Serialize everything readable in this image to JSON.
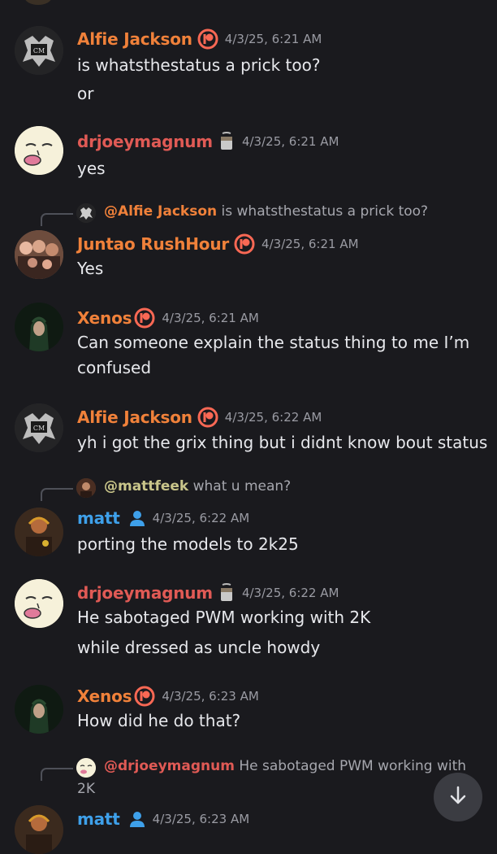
{
  "colors": {
    "background": "#1a1a1e",
    "orange_name": "#f0813a",
    "red_name": "#e05a55",
    "blue_name": "#3ea0ea",
    "olive_name": "#c9c58a",
    "patreon": "#f96854",
    "timestamp": "#9a9ba3"
  },
  "messages": [
    {
      "username": "Alfie Jackson",
      "badge": "patreon-icon",
      "timestamp": "4/3/25, 6:21 AM",
      "lines": [
        "is whatsthestatus a prick too?",
        "or"
      ]
    },
    {
      "username": "drjoeymagnum",
      "badge": "paint-bucket-icon",
      "timestamp": "4/3/25, 6:21 AM",
      "lines": [
        "yes"
      ]
    },
    {
      "reply": {
        "mention": "@Alfie Jackson",
        "text": "is whatsthestatus a prick too?"
      },
      "username": "Juntao RushHour",
      "badge": "patreon-icon",
      "timestamp": "4/3/25, 6:21 AM",
      "lines": [
        "Yes"
      ]
    },
    {
      "username": "Xenos",
      "badge": "patreon-icon",
      "timestamp": "4/3/25, 6:21 AM",
      "lines": [
        "Can someone explain the status thing to me I’m",
        "confused"
      ]
    },
    {
      "username": "Alfie Jackson",
      "badge": "patreon-icon",
      "timestamp": "4/3/25, 6:22 AM",
      "lines": [
        "yh i got the grix thing but i didnt know bout status"
      ]
    },
    {
      "reply": {
        "mention": "@mattfeek",
        "text": "what u mean?"
      },
      "username": "matt",
      "badge": "person-icon",
      "timestamp": "4/3/25, 6:22 AM",
      "lines": [
        "porting the models to 2k25"
      ]
    },
    {
      "username": "drjoeymagnum",
      "badge": "paint-bucket-icon",
      "timestamp": "4/3/25, 6:22 AM",
      "lines": [
        "He sabotaged PWM working with 2K",
        "while dressed as uncle howdy"
      ]
    },
    {
      "username": "Xenos",
      "badge": "patreon-icon",
      "timestamp": "4/3/25, 6:23 AM",
      "lines": [
        "How did he do that?"
      ]
    },
    {
      "reply": {
        "mention": "@drjoeymagnum",
        "text": "He sabotaged PWM working with",
        "text2": "2K"
      },
      "username": "matt",
      "badge": "person-icon",
      "timestamp": "4/3/25, 6:23 AM",
      "lines": []
    }
  ],
  "scroll_button": {
    "icon": "arrow-down-icon"
  }
}
